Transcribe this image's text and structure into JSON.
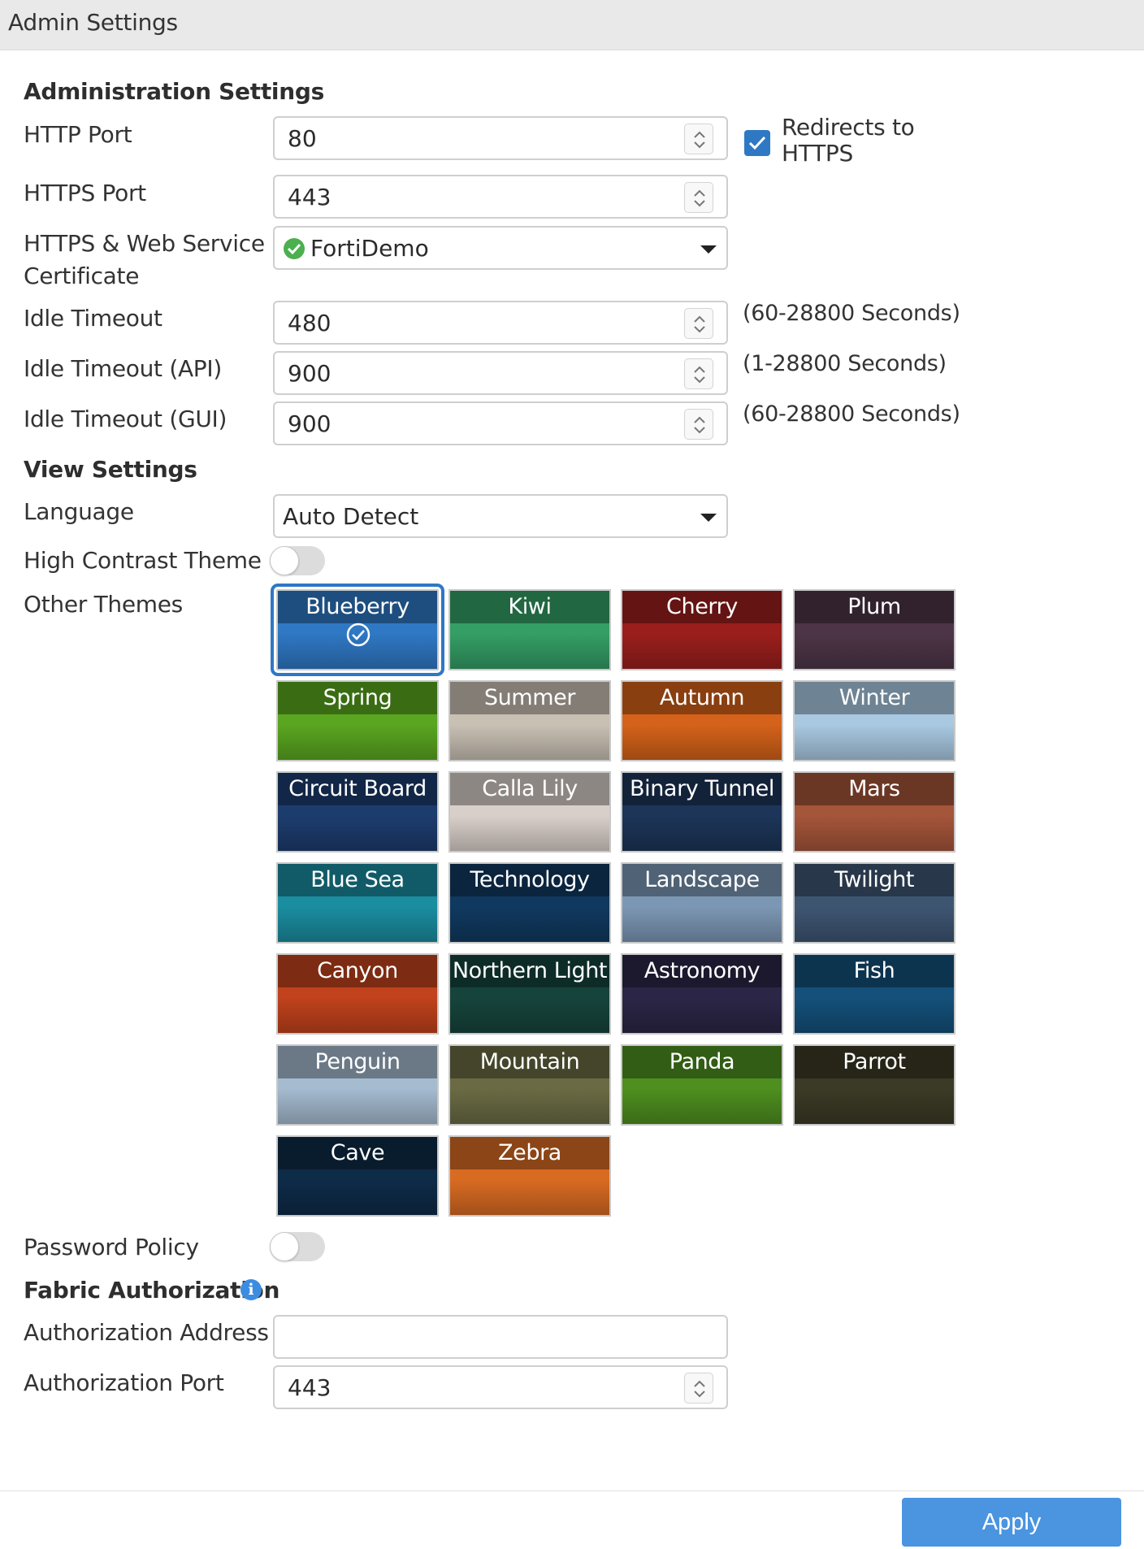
{
  "window": {
    "title": "Admin Settings"
  },
  "admin": {
    "heading": "Administration Settings",
    "http_port": {
      "label": "HTTP Port",
      "value": "80"
    },
    "redirect": {
      "label": "Redirects to HTTPS",
      "label_line1": "Redirects to",
      "label_line2": "HTTPS",
      "checked": true
    },
    "https_port": {
      "label": "HTTPS Port",
      "value": "443"
    },
    "certificate": {
      "label_line1": "HTTPS & Web Service",
      "label_line2": "Certificate",
      "value": "FortiDemo"
    },
    "idle_timeout": {
      "label": "Idle Timeout",
      "value": "480",
      "hint": "(60-28800 Seconds)"
    },
    "idle_timeout_api": {
      "label": "Idle Timeout (API)",
      "value": "900",
      "hint": "(1-28800 Seconds)"
    },
    "idle_timeout_gui": {
      "label": "Idle Timeout (GUI)",
      "value": "900",
      "hint": "(60-28800 Seconds)"
    }
  },
  "view": {
    "heading": "View Settings",
    "language": {
      "label": "Language",
      "value": "Auto Detect"
    },
    "high_contrast": {
      "label": "High Contrast Theme",
      "enabled": false
    },
    "other_themes": {
      "label": "Other Themes",
      "selected": "Blueberry"
    }
  },
  "themes": [
    {
      "name": "Blueberry",
      "color": "#2f78c4"
    },
    {
      "name": "Kiwi",
      "color": "#349e65"
    },
    {
      "name": "Cherry",
      "color": "#9a1f1c"
    },
    {
      "name": "Plum",
      "color": "#4d3547"
    },
    {
      "name": "Spring",
      "color": "#5aa620"
    },
    {
      "name": "Summer",
      "color": "#c9c0b4"
    },
    {
      "name": "Autumn",
      "color": "#d4621a"
    },
    {
      "name": "Winter",
      "color": "#a9c9e2"
    },
    {
      "name": "Circuit Board",
      "color": "#1d3c6e"
    },
    {
      "name": "Calla Lily",
      "color": "#d9cfca"
    },
    {
      "name": "Binary Tunnel",
      "color": "#1c3558"
    },
    {
      "name": "Mars",
      "color": "#a5553a"
    },
    {
      "name": "Blue Sea",
      "color": "#1b8da0"
    },
    {
      "name": "Technology",
      "color": "#10395f"
    },
    {
      "name": "Landscape",
      "color": "#7c97b4"
    },
    {
      "name": "Twilight",
      "color": "#3e5572"
    },
    {
      "name": "Canyon",
      "color": "#c1421c"
    },
    {
      "name": "Northern Light",
      "color": "#16443c"
    },
    {
      "name": "Astronomy",
      "color": "#2b2646"
    },
    {
      "name": "Fish",
      "color": "#14507a"
    },
    {
      "name": "Penguin",
      "color": "#a5bbd0"
    },
    {
      "name": "Mountain",
      "color": "#6a6b44"
    },
    {
      "name": "Panda",
      "color": "#4e8f1f"
    },
    {
      "name": "Parrot",
      "color": "#3b3a26"
    },
    {
      "name": "Cave",
      "color": "#0e2b48"
    },
    {
      "name": "Zebra",
      "color": "#d86b22"
    }
  ],
  "password_policy": {
    "label": "Password Policy",
    "enabled": false
  },
  "fabric": {
    "heading": "Fabric Authorization",
    "address": {
      "label": "Authorization Address",
      "value": ""
    },
    "port": {
      "label": "Authorization Port",
      "value": "443"
    }
  },
  "footer": {
    "apply_label": "Apply"
  }
}
